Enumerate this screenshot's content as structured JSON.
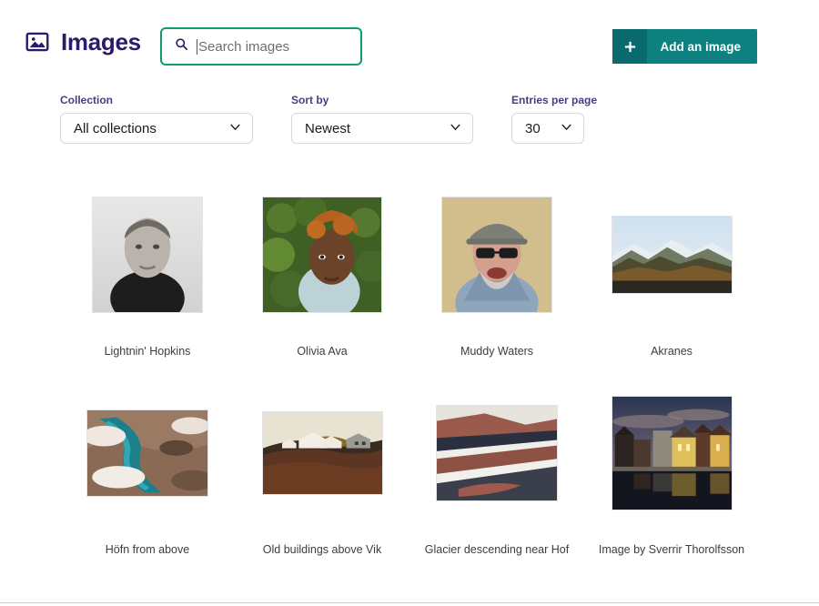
{
  "header": {
    "title": "Images",
    "image_icon": "image-icon",
    "search": {
      "icon": "search-icon",
      "placeholder": "Search images",
      "value": ""
    },
    "add_button": {
      "icon": "plus-icon",
      "label": "Add an image"
    }
  },
  "filters": [
    {
      "label": "Collection",
      "value": "All collections",
      "icon": "chevron-down-icon"
    },
    {
      "label": "Sort by",
      "value": "Newest",
      "icon": "chevron-down-icon"
    },
    {
      "label": "Entries per page",
      "value": "30",
      "icon": "chevron-down-icon"
    }
  ],
  "grid": {
    "items": [
      {
        "caption": "Lightnin' Hopkins",
        "w": 122,
        "h": 128,
        "kind": "portrait-bw"
      },
      {
        "caption": "Olivia Ava",
        "w": 132,
        "h": 128,
        "kind": "portrait-foliage"
      },
      {
        "caption": "Muddy Waters",
        "w": 122,
        "h": 128,
        "kind": "portrait-cap"
      },
      {
        "caption": "Akranes",
        "w": 133,
        "h": 86,
        "kind": "mountains"
      },
      {
        "caption": "Höfn from above",
        "w": 134,
        "h": 96,
        "kind": "aerial-delta"
      },
      {
        "caption": "Old buildings above Vik",
        "w": 133,
        "h": 92,
        "kind": "houses-hill"
      },
      {
        "caption": "Glacier descending near Hof",
        "w": 134,
        "h": 106,
        "kind": "glacier"
      },
      {
        "caption": "Image by Sverrir Thorolfsson",
        "w": 133,
        "h": 126,
        "kind": "town-dusk"
      }
    ]
  },
  "colors": {
    "title_purple": "#2d1b69",
    "label_purple": "#4a3b86",
    "search_border_green": "#0f9d63",
    "button_teal": "#0d8080",
    "button_teal_dark": "#0a6b6e"
  }
}
